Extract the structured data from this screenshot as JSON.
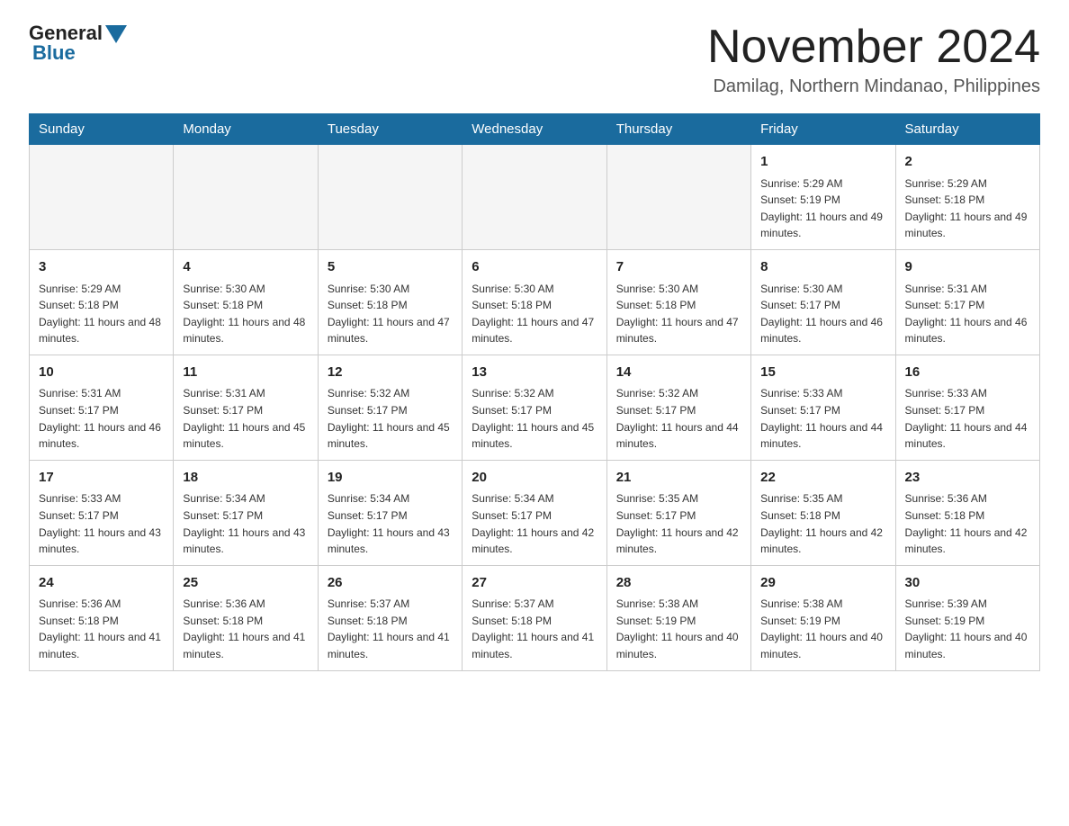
{
  "logo": {
    "part1": "General",
    "part2": "Blue"
  },
  "header": {
    "title": "November 2024",
    "subtitle": "Damilag, Northern Mindanao, Philippines"
  },
  "days_of_week": [
    "Sunday",
    "Monday",
    "Tuesday",
    "Wednesday",
    "Thursday",
    "Friday",
    "Saturday"
  ],
  "weeks": [
    [
      {
        "day": "",
        "info": ""
      },
      {
        "day": "",
        "info": ""
      },
      {
        "day": "",
        "info": ""
      },
      {
        "day": "",
        "info": ""
      },
      {
        "day": "",
        "info": ""
      },
      {
        "day": "1",
        "info": "Sunrise: 5:29 AM\nSunset: 5:19 PM\nDaylight: 11 hours and 49 minutes."
      },
      {
        "day": "2",
        "info": "Sunrise: 5:29 AM\nSunset: 5:18 PM\nDaylight: 11 hours and 49 minutes."
      }
    ],
    [
      {
        "day": "3",
        "info": "Sunrise: 5:29 AM\nSunset: 5:18 PM\nDaylight: 11 hours and 48 minutes."
      },
      {
        "day": "4",
        "info": "Sunrise: 5:30 AM\nSunset: 5:18 PM\nDaylight: 11 hours and 48 minutes."
      },
      {
        "day": "5",
        "info": "Sunrise: 5:30 AM\nSunset: 5:18 PM\nDaylight: 11 hours and 47 minutes."
      },
      {
        "day": "6",
        "info": "Sunrise: 5:30 AM\nSunset: 5:18 PM\nDaylight: 11 hours and 47 minutes."
      },
      {
        "day": "7",
        "info": "Sunrise: 5:30 AM\nSunset: 5:18 PM\nDaylight: 11 hours and 47 minutes."
      },
      {
        "day": "8",
        "info": "Sunrise: 5:30 AM\nSunset: 5:17 PM\nDaylight: 11 hours and 46 minutes."
      },
      {
        "day": "9",
        "info": "Sunrise: 5:31 AM\nSunset: 5:17 PM\nDaylight: 11 hours and 46 minutes."
      }
    ],
    [
      {
        "day": "10",
        "info": "Sunrise: 5:31 AM\nSunset: 5:17 PM\nDaylight: 11 hours and 46 minutes."
      },
      {
        "day": "11",
        "info": "Sunrise: 5:31 AM\nSunset: 5:17 PM\nDaylight: 11 hours and 45 minutes."
      },
      {
        "day": "12",
        "info": "Sunrise: 5:32 AM\nSunset: 5:17 PM\nDaylight: 11 hours and 45 minutes."
      },
      {
        "day": "13",
        "info": "Sunrise: 5:32 AM\nSunset: 5:17 PM\nDaylight: 11 hours and 45 minutes."
      },
      {
        "day": "14",
        "info": "Sunrise: 5:32 AM\nSunset: 5:17 PM\nDaylight: 11 hours and 44 minutes."
      },
      {
        "day": "15",
        "info": "Sunrise: 5:33 AM\nSunset: 5:17 PM\nDaylight: 11 hours and 44 minutes."
      },
      {
        "day": "16",
        "info": "Sunrise: 5:33 AM\nSunset: 5:17 PM\nDaylight: 11 hours and 44 minutes."
      }
    ],
    [
      {
        "day": "17",
        "info": "Sunrise: 5:33 AM\nSunset: 5:17 PM\nDaylight: 11 hours and 43 minutes."
      },
      {
        "day": "18",
        "info": "Sunrise: 5:34 AM\nSunset: 5:17 PM\nDaylight: 11 hours and 43 minutes."
      },
      {
        "day": "19",
        "info": "Sunrise: 5:34 AM\nSunset: 5:17 PM\nDaylight: 11 hours and 43 minutes."
      },
      {
        "day": "20",
        "info": "Sunrise: 5:34 AM\nSunset: 5:17 PM\nDaylight: 11 hours and 42 minutes."
      },
      {
        "day": "21",
        "info": "Sunrise: 5:35 AM\nSunset: 5:17 PM\nDaylight: 11 hours and 42 minutes."
      },
      {
        "day": "22",
        "info": "Sunrise: 5:35 AM\nSunset: 5:18 PM\nDaylight: 11 hours and 42 minutes."
      },
      {
        "day": "23",
        "info": "Sunrise: 5:36 AM\nSunset: 5:18 PM\nDaylight: 11 hours and 42 minutes."
      }
    ],
    [
      {
        "day": "24",
        "info": "Sunrise: 5:36 AM\nSunset: 5:18 PM\nDaylight: 11 hours and 41 minutes."
      },
      {
        "day": "25",
        "info": "Sunrise: 5:36 AM\nSunset: 5:18 PM\nDaylight: 11 hours and 41 minutes."
      },
      {
        "day": "26",
        "info": "Sunrise: 5:37 AM\nSunset: 5:18 PM\nDaylight: 11 hours and 41 minutes."
      },
      {
        "day": "27",
        "info": "Sunrise: 5:37 AM\nSunset: 5:18 PM\nDaylight: 11 hours and 41 minutes."
      },
      {
        "day": "28",
        "info": "Sunrise: 5:38 AM\nSunset: 5:19 PM\nDaylight: 11 hours and 40 minutes."
      },
      {
        "day": "29",
        "info": "Sunrise: 5:38 AM\nSunset: 5:19 PM\nDaylight: 11 hours and 40 minutes."
      },
      {
        "day": "30",
        "info": "Sunrise: 5:39 AM\nSunset: 5:19 PM\nDaylight: 11 hours and 40 minutes."
      }
    ]
  ]
}
